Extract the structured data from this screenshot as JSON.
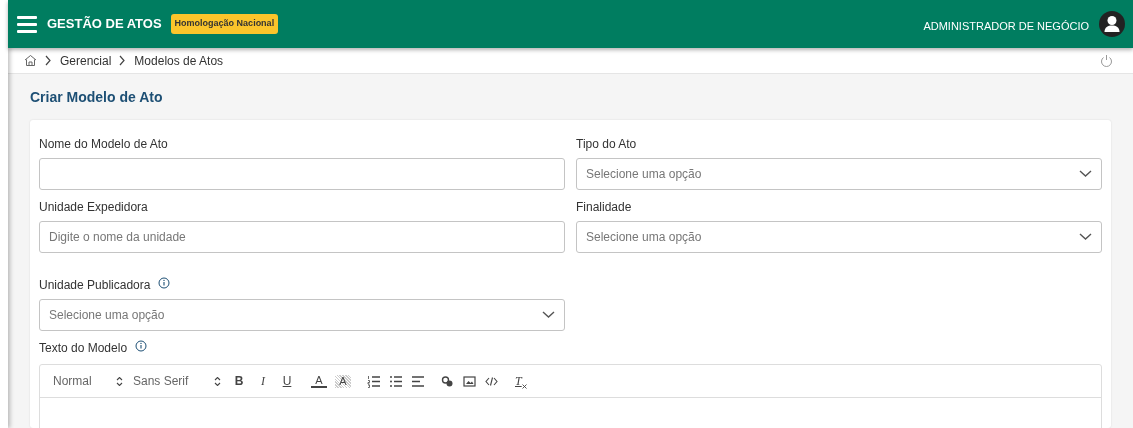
{
  "header": {
    "title": "GESTÃO DE ATOS",
    "environment_badge": "Homologação Nacional",
    "user": "ADMINISTRADOR DE NEGÓCIO"
  },
  "breadcrumb": [
    "Gerencial",
    "Modelos de Atos"
  ],
  "page_title": "Criar Modelo de Ato",
  "form_rows": [
    [
      {
        "label": "Nome do Modelo de Ato",
        "kind": "text",
        "info": false
      },
      {
        "label": "Tipo do Ato",
        "kind": "select",
        "placeholder": "Selecione uma opção",
        "info": false
      }
    ],
    [
      {
        "label": "Unidade Expedidora",
        "kind": "text",
        "placeholder": "Digite o nome da unidade",
        "info": false
      },
      {
        "label": "Finalidade",
        "kind": "select",
        "placeholder": "Selecione uma opção",
        "info": false
      }
    ],
    [
      {
        "label": "Unidade Publicadora",
        "kind": "select",
        "placeholder": "Selecione uma opção",
        "info": true
      }
    ]
  ],
  "editor": {
    "label": "Texto do Modelo",
    "info": true,
    "pickers": [
      {
        "value": "Normal"
      },
      {
        "value": "Sans Serif"
      }
    ],
    "tools": [
      {
        "kind": "bold",
        "label": "B"
      },
      {
        "kind": "italic",
        "label": "I"
      },
      {
        "kind": "underline",
        "label": "U"
      },
      {
        "kind": "color",
        "label": "A"
      },
      {
        "kind": "background",
        "label": "A"
      },
      {
        "kind": "ordered-list"
      },
      {
        "kind": "bullet-list"
      },
      {
        "kind": "align"
      },
      {
        "kind": "link"
      },
      {
        "kind": "image"
      },
      {
        "kind": "code"
      },
      {
        "kind": "clean",
        "label": "T"
      }
    ]
  }
}
